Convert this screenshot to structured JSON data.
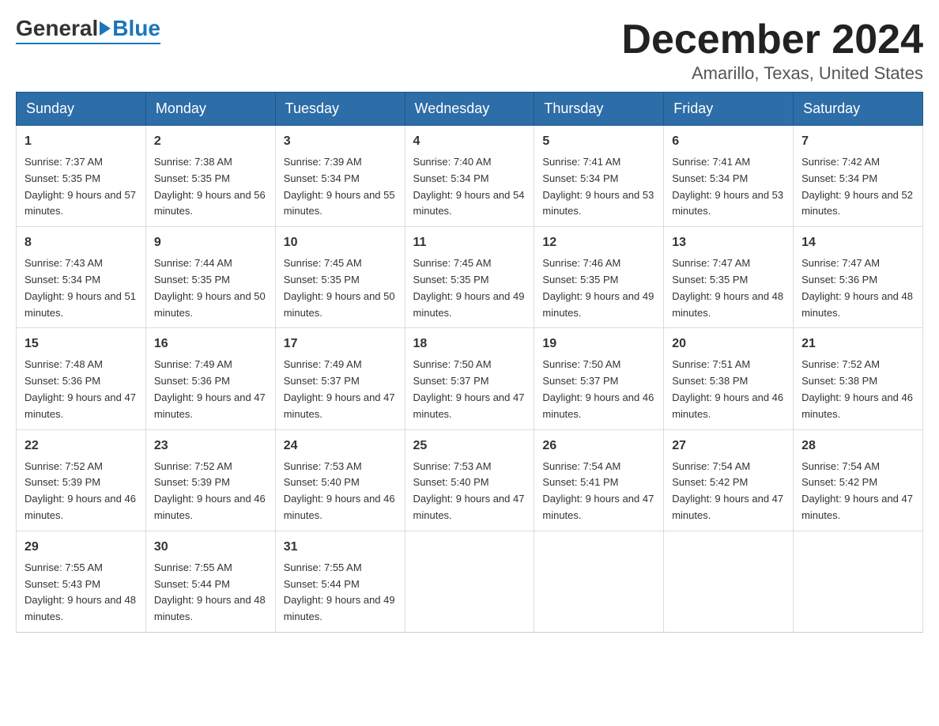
{
  "logo": {
    "general": "General",
    "blue": "Blue"
  },
  "title": "December 2024",
  "location": "Amarillo, Texas, United States",
  "headers": [
    "Sunday",
    "Monday",
    "Tuesday",
    "Wednesday",
    "Thursday",
    "Friday",
    "Saturday"
  ],
  "weeks": [
    [
      {
        "day": "1",
        "sunrise": "7:37 AM",
        "sunset": "5:35 PM",
        "daylight": "9 hours and 57 minutes."
      },
      {
        "day": "2",
        "sunrise": "7:38 AM",
        "sunset": "5:35 PM",
        "daylight": "9 hours and 56 minutes."
      },
      {
        "day": "3",
        "sunrise": "7:39 AM",
        "sunset": "5:34 PM",
        "daylight": "9 hours and 55 minutes."
      },
      {
        "day": "4",
        "sunrise": "7:40 AM",
        "sunset": "5:34 PM",
        "daylight": "9 hours and 54 minutes."
      },
      {
        "day": "5",
        "sunrise": "7:41 AM",
        "sunset": "5:34 PM",
        "daylight": "9 hours and 53 minutes."
      },
      {
        "day": "6",
        "sunrise": "7:41 AM",
        "sunset": "5:34 PM",
        "daylight": "9 hours and 53 minutes."
      },
      {
        "day": "7",
        "sunrise": "7:42 AM",
        "sunset": "5:34 PM",
        "daylight": "9 hours and 52 minutes."
      }
    ],
    [
      {
        "day": "8",
        "sunrise": "7:43 AM",
        "sunset": "5:34 PM",
        "daylight": "9 hours and 51 minutes."
      },
      {
        "day": "9",
        "sunrise": "7:44 AM",
        "sunset": "5:35 PM",
        "daylight": "9 hours and 50 minutes."
      },
      {
        "day": "10",
        "sunrise": "7:45 AM",
        "sunset": "5:35 PM",
        "daylight": "9 hours and 50 minutes."
      },
      {
        "day": "11",
        "sunrise": "7:45 AM",
        "sunset": "5:35 PM",
        "daylight": "9 hours and 49 minutes."
      },
      {
        "day": "12",
        "sunrise": "7:46 AM",
        "sunset": "5:35 PM",
        "daylight": "9 hours and 49 minutes."
      },
      {
        "day": "13",
        "sunrise": "7:47 AM",
        "sunset": "5:35 PM",
        "daylight": "9 hours and 48 minutes."
      },
      {
        "day": "14",
        "sunrise": "7:47 AM",
        "sunset": "5:36 PM",
        "daylight": "9 hours and 48 minutes."
      }
    ],
    [
      {
        "day": "15",
        "sunrise": "7:48 AM",
        "sunset": "5:36 PM",
        "daylight": "9 hours and 47 minutes."
      },
      {
        "day": "16",
        "sunrise": "7:49 AM",
        "sunset": "5:36 PM",
        "daylight": "9 hours and 47 minutes."
      },
      {
        "day": "17",
        "sunrise": "7:49 AM",
        "sunset": "5:37 PM",
        "daylight": "9 hours and 47 minutes."
      },
      {
        "day": "18",
        "sunrise": "7:50 AM",
        "sunset": "5:37 PM",
        "daylight": "9 hours and 47 minutes."
      },
      {
        "day": "19",
        "sunrise": "7:50 AM",
        "sunset": "5:37 PM",
        "daylight": "9 hours and 46 minutes."
      },
      {
        "day": "20",
        "sunrise": "7:51 AM",
        "sunset": "5:38 PM",
        "daylight": "9 hours and 46 minutes."
      },
      {
        "day": "21",
        "sunrise": "7:52 AM",
        "sunset": "5:38 PM",
        "daylight": "9 hours and 46 minutes."
      }
    ],
    [
      {
        "day": "22",
        "sunrise": "7:52 AM",
        "sunset": "5:39 PM",
        "daylight": "9 hours and 46 minutes."
      },
      {
        "day": "23",
        "sunrise": "7:52 AM",
        "sunset": "5:39 PM",
        "daylight": "9 hours and 46 minutes."
      },
      {
        "day": "24",
        "sunrise": "7:53 AM",
        "sunset": "5:40 PM",
        "daylight": "9 hours and 46 minutes."
      },
      {
        "day": "25",
        "sunrise": "7:53 AM",
        "sunset": "5:40 PM",
        "daylight": "9 hours and 47 minutes."
      },
      {
        "day": "26",
        "sunrise": "7:54 AM",
        "sunset": "5:41 PM",
        "daylight": "9 hours and 47 minutes."
      },
      {
        "day": "27",
        "sunrise": "7:54 AM",
        "sunset": "5:42 PM",
        "daylight": "9 hours and 47 minutes."
      },
      {
        "day": "28",
        "sunrise": "7:54 AM",
        "sunset": "5:42 PM",
        "daylight": "9 hours and 47 minutes."
      }
    ],
    [
      {
        "day": "29",
        "sunrise": "7:55 AM",
        "sunset": "5:43 PM",
        "daylight": "9 hours and 48 minutes."
      },
      {
        "day": "30",
        "sunrise": "7:55 AM",
        "sunset": "5:44 PM",
        "daylight": "9 hours and 48 minutes."
      },
      {
        "day": "31",
        "sunrise": "7:55 AM",
        "sunset": "5:44 PM",
        "daylight": "9 hours and 49 minutes."
      },
      null,
      null,
      null,
      null
    ]
  ]
}
